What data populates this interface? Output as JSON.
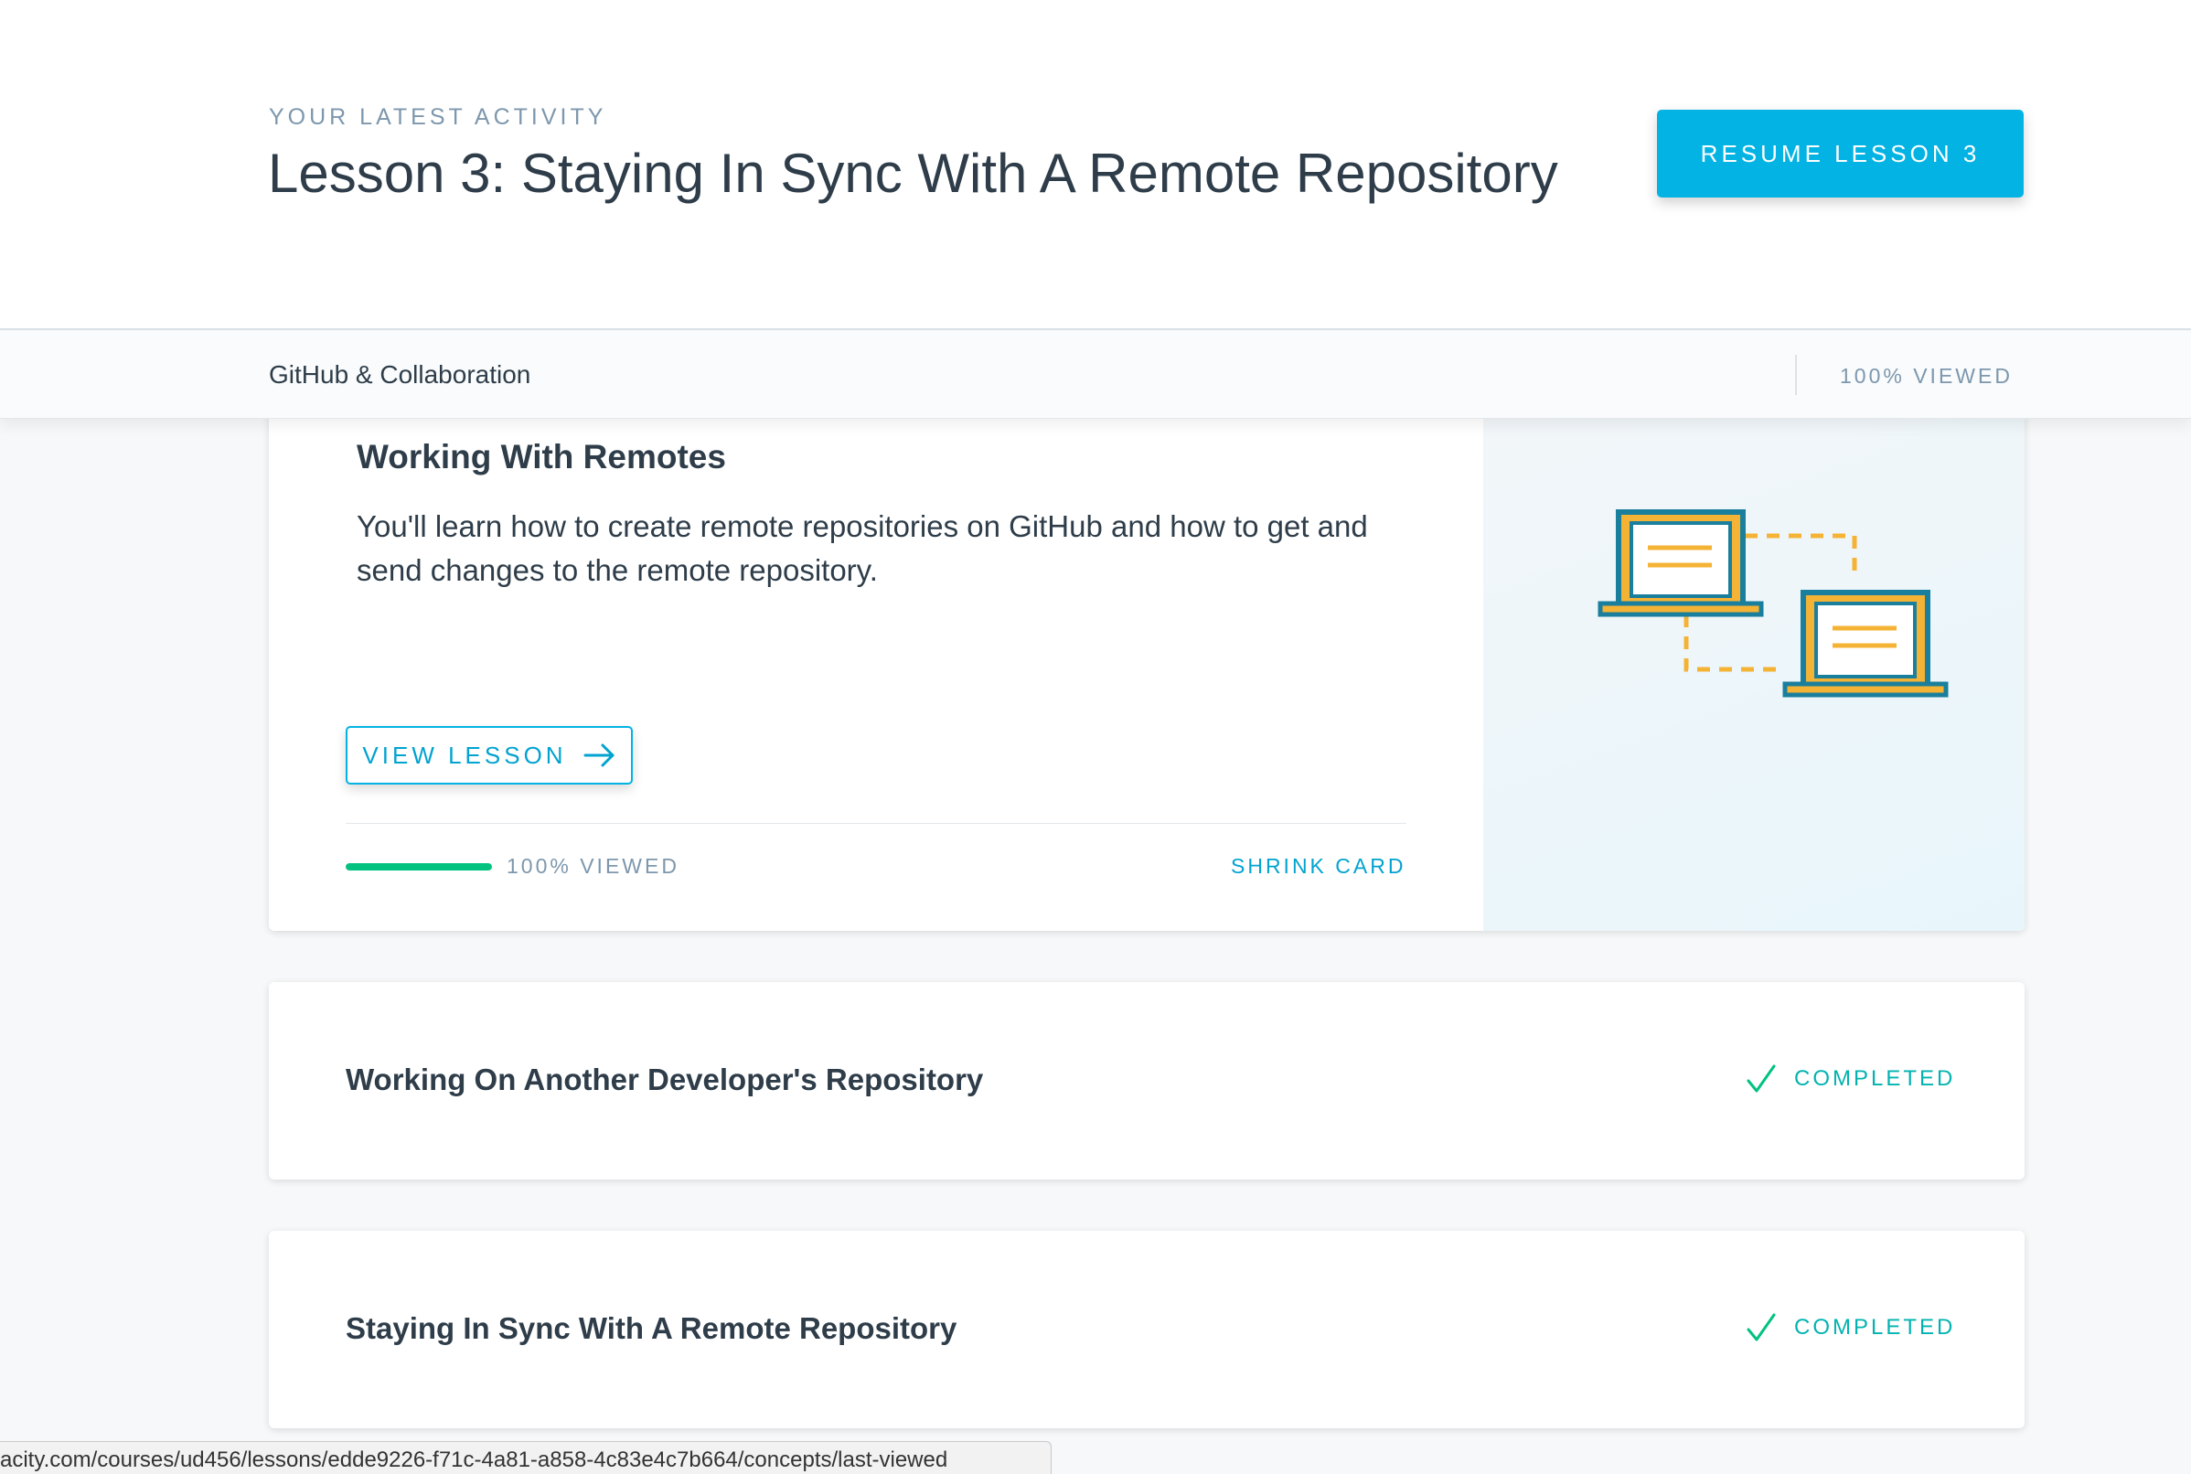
{
  "header": {
    "eyebrow": "YOUR LATEST ACTIVITY",
    "lesson_title": "Lesson 3: Staying In Sync With A Remote Repository",
    "resume_label": "RESUME LESSON 3"
  },
  "subheader": {
    "course_name": "GitHub & Collaboration",
    "viewed_label": "100% VIEWED"
  },
  "expanded_card": {
    "title": "Working With Remotes",
    "description": "You'll learn how to create remote repositories on GitHub and how to get and send changes to the remote repository.",
    "view_button_label": "VIEW LESSON",
    "progress_fraction": 1.0,
    "progress_label": "100% VIEWED",
    "shrink_label": "SHRINK CARD",
    "illustration": "two-laptops-sync-icon"
  },
  "lessons": [
    {
      "title": "Working On Another Developer's Repository",
      "status": "COMPLETED"
    },
    {
      "title": "Staying In Sync With A Remote Repository",
      "status": "COMPLETED"
    }
  ],
  "status_bar": {
    "url": "acity.com/courses/ud456/lessons/edde9226-f71c-4a81-a858-4c83e4c7b664/concepts/last-viewed"
  },
  "colors": {
    "accent": "#02b3e4",
    "progress": "#02c27f",
    "completed": "#02b3b0",
    "illustration_teal": "#1a7f9c",
    "illustration_gold": "#f5b335"
  }
}
